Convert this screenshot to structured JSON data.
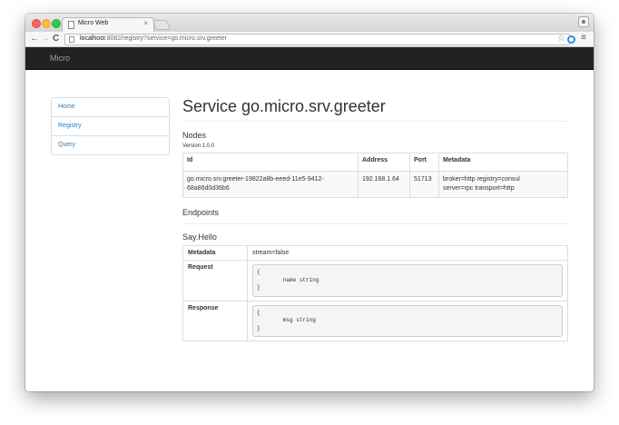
{
  "browser": {
    "tab_title": "Micro Web",
    "tab_close": "×",
    "url_host": "localhost",
    "url_rest": ":8082/registry?service=go.micro.srv.greeter",
    "back_glyph": "←",
    "forward_glyph": "→",
    "reload_glyph": "C",
    "star_glyph": "☆",
    "menu_glyph": "≡"
  },
  "navbar": {
    "brand": "Micro"
  },
  "sidebar": {
    "items": [
      {
        "label": "Home"
      },
      {
        "label": "Registry"
      },
      {
        "label": "Query"
      }
    ]
  },
  "service": {
    "title": "Service go.micro.srv.greeter",
    "nodes_heading": "Nodes",
    "version": "Version 1.0.0",
    "nodes_table": {
      "headers": [
        "Id",
        "Address",
        "Port",
        "Metadata"
      ],
      "rows": [
        {
          "id_line1": "go.micro.srv.greeter-19822a8b-eeed-11e5-9412-",
          "id_line2": "68a86d0d36b6",
          "address": "192.168.1.64",
          "port": "51713",
          "metadata_line1": "broker=http registry=consul",
          "metadata_line2": "server=rpc transport=http"
        }
      ]
    },
    "endpoints_heading": "Endpoints",
    "endpoint": {
      "name": "Say.Hello",
      "metadata_label": "Metadata",
      "metadata_value": "stream=false",
      "request_label": "Request",
      "request_code": "{\n\tname string\n}",
      "response_label": "Response",
      "response_code": "{\n\tmsg string\n}"
    }
  }
}
